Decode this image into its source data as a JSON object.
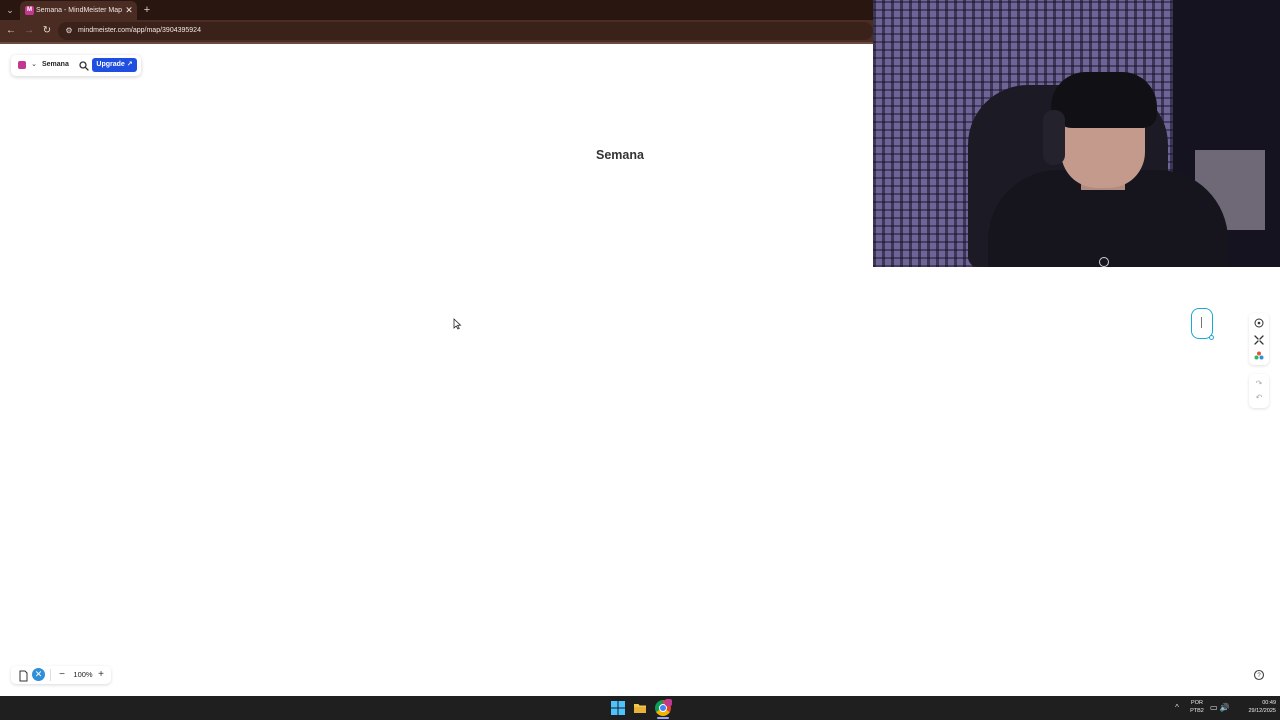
{
  "browser": {
    "tab": {
      "title": "Semana - MindMeister Mapa m",
      "close_glyph": "✕"
    },
    "tab_list_glyph": "⌄",
    "new_tab_glyph": "+",
    "nav": {
      "back": "←",
      "forward": "→",
      "reload": "↻"
    },
    "url": "mindmeister.com/app/map/3904395924",
    "site_info_glyph": "⚙"
  },
  "app": {
    "brand_color": "#c2388e",
    "menu_chevron": "⌄",
    "map_name": "Semana",
    "upgrade_label": "Upgrade ↗",
    "upgrade_color": "#1f4fe0"
  },
  "canvas": {
    "root_node_text": "Semana",
    "node_accent": "#1aa8d6"
  },
  "right_toolbar": {
    "icons": [
      "target-icon",
      "collapse-icon",
      "style-icon",
      "redo-icon",
      "undo-icon"
    ],
    "redo_glyph": "↷",
    "undo_glyph": "↶"
  },
  "bottom_bar": {
    "zoom_out": "−",
    "zoom_level": "100%",
    "zoom_in": "+"
  },
  "taskbar": {
    "tray_chevron": "^",
    "lang_line1": "POR",
    "lang_line2": "PTB2",
    "time": "00:49",
    "date": "29/12/2025",
    "tray_icons": "▭ 🔊"
  }
}
